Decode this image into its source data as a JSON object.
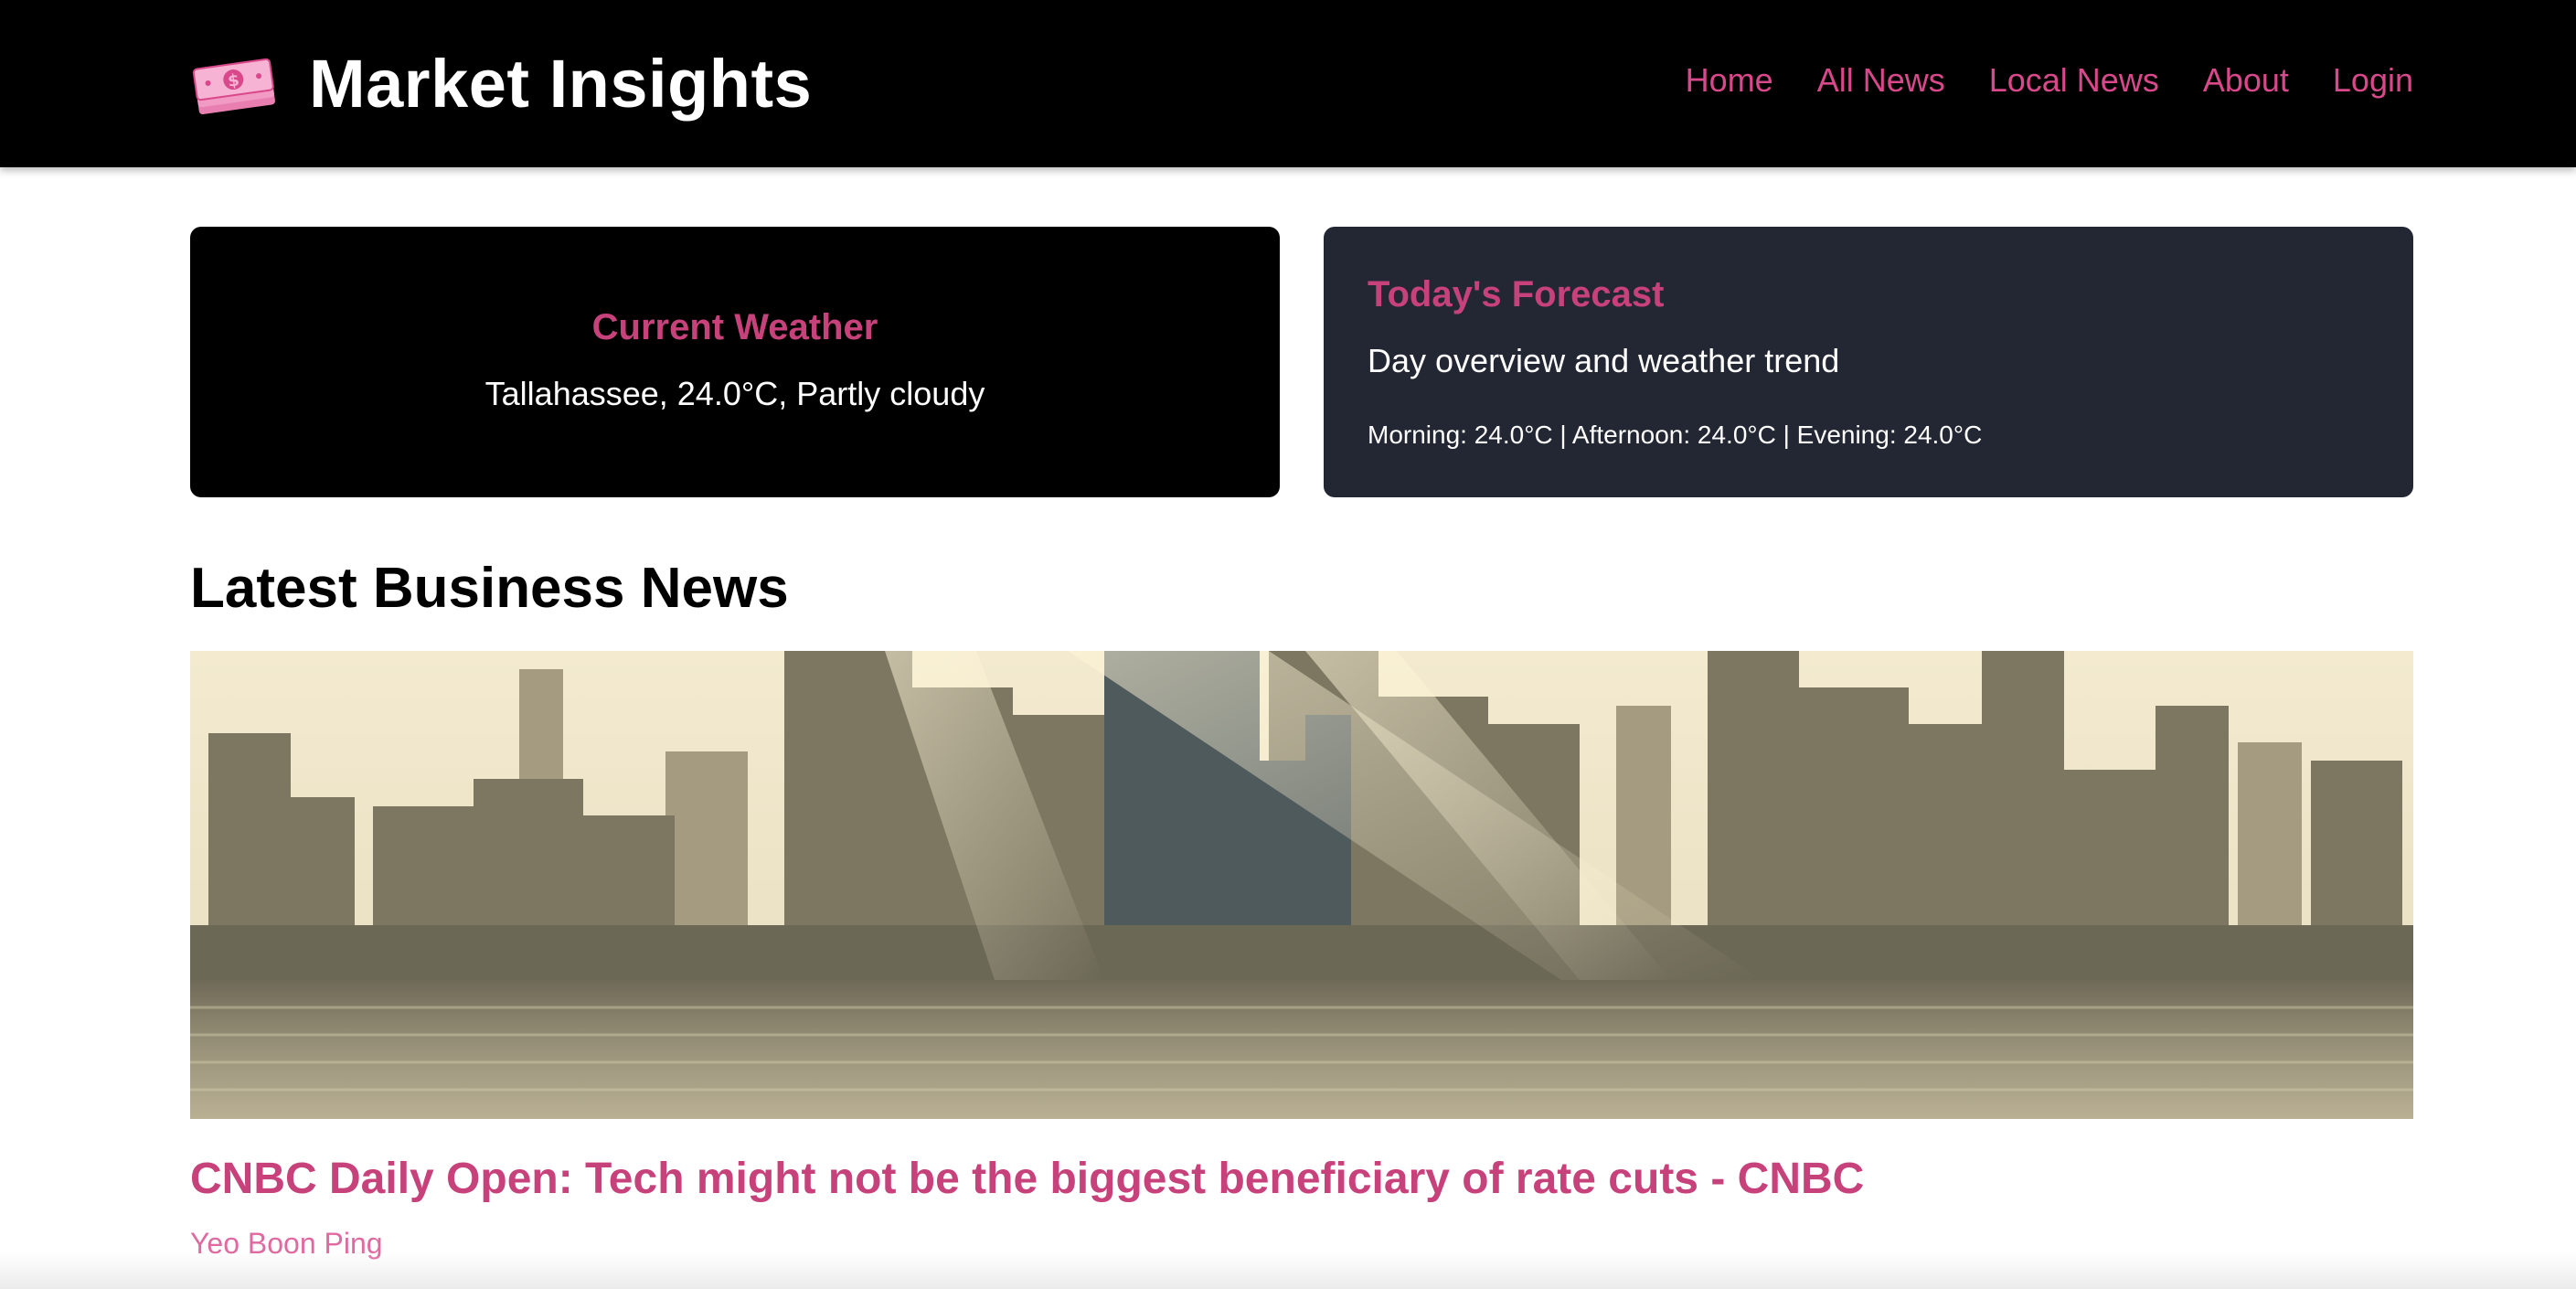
{
  "header": {
    "title": "Market Insights",
    "logo_icon": "money-icon",
    "nav": [
      {
        "label": "Home"
      },
      {
        "label": "All News"
      },
      {
        "label": "Local News"
      },
      {
        "label": "About"
      },
      {
        "label": "Login"
      }
    ]
  },
  "weather": {
    "title": "Current Weather",
    "text": "Tallahassee, 24.0°C, Partly cloudy"
  },
  "forecast": {
    "title": "Today's Forecast",
    "subtitle": "Day overview and weather trend",
    "detail": "Morning: 24.0°C | Afternoon: 24.0°C | Evening: 24.0°C"
  },
  "news": {
    "heading": "Latest Business News",
    "articles": [
      {
        "image": "city-skyline-photo",
        "title": "CNBC Daily Open: Tech might not be the biggest beneficiary of rate cuts - CNBC",
        "author": "Yeo Boon Ping"
      }
    ]
  },
  "colors": {
    "accent": "#c7417b",
    "nav_link": "#d9488a",
    "header_bg": "#000000",
    "forecast_bg": "#222733"
  }
}
